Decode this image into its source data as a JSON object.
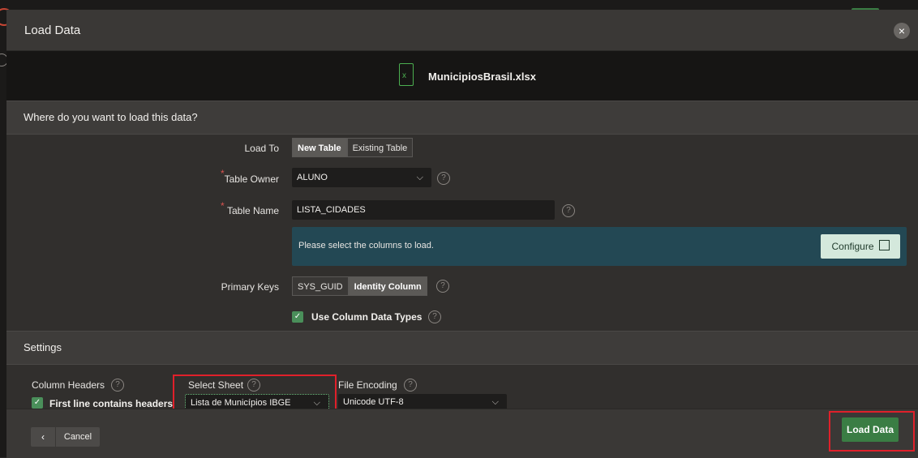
{
  "dialog": {
    "title": "Load Data",
    "close_icon": "×"
  },
  "file": {
    "name": "MunicipiosBrasil.xlsx",
    "icon": "excel-file-icon"
  },
  "load_section": {
    "heading": "Where do you want to load this data?",
    "load_to": {
      "label": "Load To",
      "options": [
        "New Table",
        "Existing Table"
      ],
      "selected": "New Table"
    },
    "table_owner": {
      "label": "Table Owner",
      "value": "ALUNO",
      "required": "*"
    },
    "table_name": {
      "label": "Table Name",
      "value": "LISTA_CIDADES",
      "required": "*"
    },
    "columns_info": {
      "text": "Please select the columns to load.",
      "button": "Configure"
    },
    "primary_keys": {
      "label": "Primary Keys",
      "options": [
        "SYS_GUID",
        "Identity Column"
      ],
      "selected": "Identity Column"
    },
    "use_column_types": {
      "label": "Use Column Data Types",
      "checked": true
    }
  },
  "settings": {
    "heading": "Settings",
    "column_headers": {
      "label": "Column Headers",
      "checkbox_label": "First line contains headers"
    },
    "select_sheet": {
      "label": "Select Sheet",
      "value": "Lista de Municípios IBGE"
    },
    "file_encoding": {
      "label": "File Encoding",
      "value": "Unicode UTF-8"
    }
  },
  "footer": {
    "back": "‹",
    "cancel": "Cancel",
    "load": "Load Data"
  },
  "help_glyph": "?",
  "chevron_glyph": "⌵",
  "check_glyph": "✓",
  "colors": {
    "accent_green": "#3a7d44",
    "info_teal": "#234854",
    "highlight_red": "#e0202a"
  }
}
